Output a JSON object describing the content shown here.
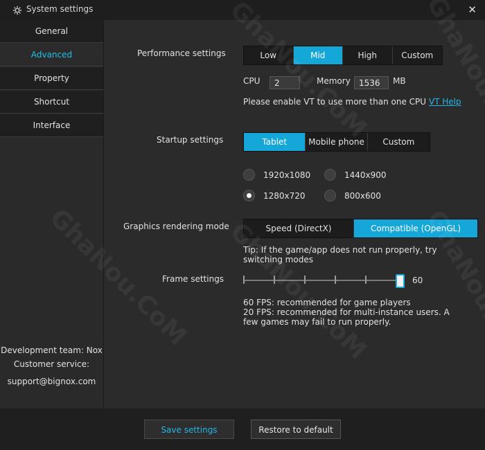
{
  "window": {
    "title": "System settings",
    "close_icon": "close-icon"
  },
  "sidebar": {
    "items": [
      {
        "label": "General"
      },
      {
        "label": "Advanced"
      },
      {
        "label": "Property"
      },
      {
        "label": "Shortcut"
      },
      {
        "label": "Interface"
      }
    ],
    "active": "Advanced",
    "footer": {
      "team": "Development team: Nox",
      "service": "Customer service:",
      "email": "support@bignox.com"
    }
  },
  "performance": {
    "label": "Performance settings",
    "options": [
      "Low",
      "Mid",
      "High",
      "Custom"
    ],
    "selected": "Mid",
    "cpu_label": "CPU",
    "cpu_value": "2",
    "memory_label": "Memory",
    "memory_value": "1536",
    "memory_unit": "MB",
    "vt_note": "Please enable VT to use more than one CPU",
    "vt_link": "VT Help"
  },
  "startup": {
    "label": "Startup settings",
    "options": [
      "Tablet",
      "Mobile phone",
      "Custom"
    ],
    "selected": "Tablet",
    "resolutions": [
      "1920x1080",
      "1440x900",
      "1280x720",
      "800x600"
    ],
    "resolution_selected": "1280x720"
  },
  "graphics": {
    "label": "Graphics rendering mode",
    "options": [
      "Speed (DirectX)",
      "Compatible (OpenGL)"
    ],
    "selected": "Compatible (OpenGL)",
    "tip": "Tip: If the game/app does not run properly, try switching modes"
  },
  "frame": {
    "label": "Frame settings",
    "value": "60",
    "level": 1.0,
    "note1": "60 FPS: recommended for game players",
    "note2": "20 FPS: recommended for multi-instance users. A few games may fail to run properly."
  },
  "buttons": {
    "save": "Save settings",
    "restore": "Restore to default"
  },
  "watermark": "GhaNou.CoM",
  "colors": {
    "accent": "#16a7d9",
    "link": "#23b7e6",
    "active_text": "#22c2e8"
  }
}
